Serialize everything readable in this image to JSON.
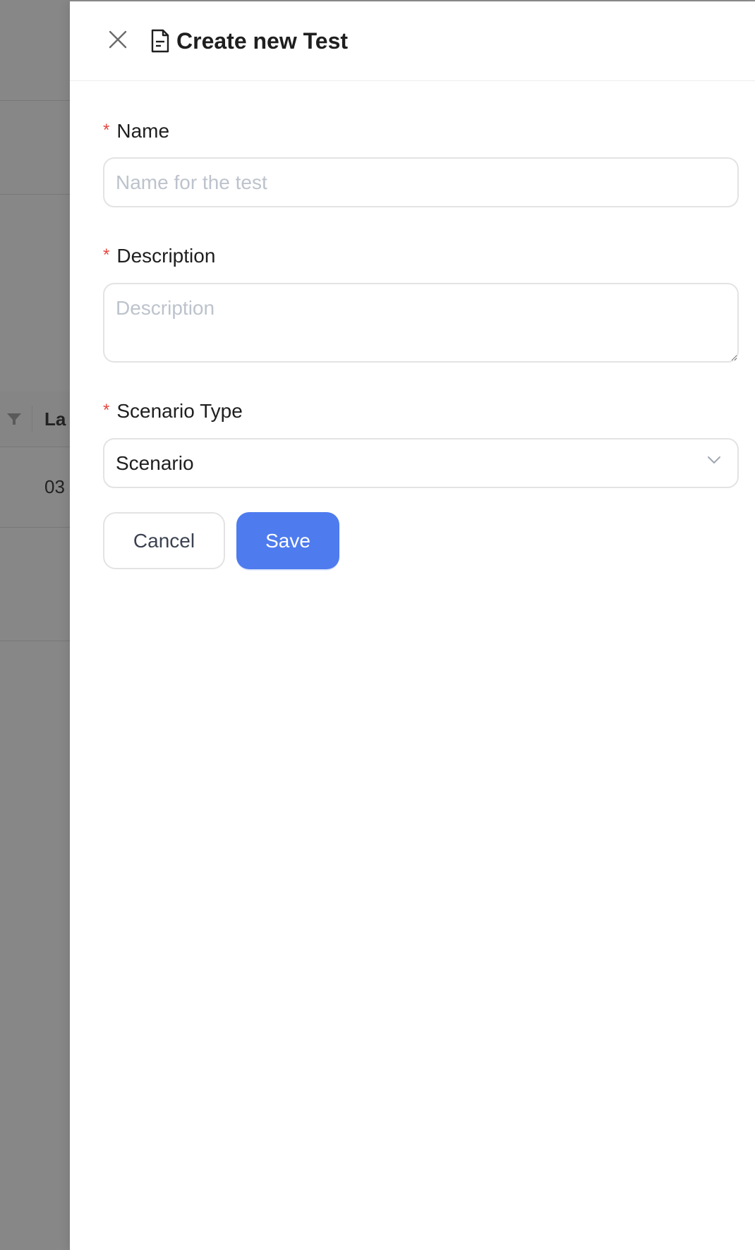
{
  "background": {
    "column_title": "La",
    "cell_value": "03"
  },
  "drawer": {
    "title": "Create new Test",
    "fields": {
      "name": {
        "required_mark": "*",
        "label": "Name",
        "placeholder": "Name for the test",
        "value": ""
      },
      "description": {
        "required_mark": "*",
        "label": "Description",
        "placeholder": "Description",
        "value": ""
      },
      "scenario_type": {
        "required_mark": "*",
        "label": "Scenario Type",
        "selected": "Scenario"
      }
    },
    "buttons": {
      "cancel": "Cancel",
      "save": "Save"
    }
  },
  "colors": {
    "primary": "#4e7bee",
    "required": "#e5483f",
    "placeholder": "#bdc3cc",
    "overlay": "#878787"
  },
  "icons": {
    "close": "close-icon",
    "document": "document-icon",
    "chevron": "chevron-down-icon",
    "filter": "filter-icon"
  }
}
